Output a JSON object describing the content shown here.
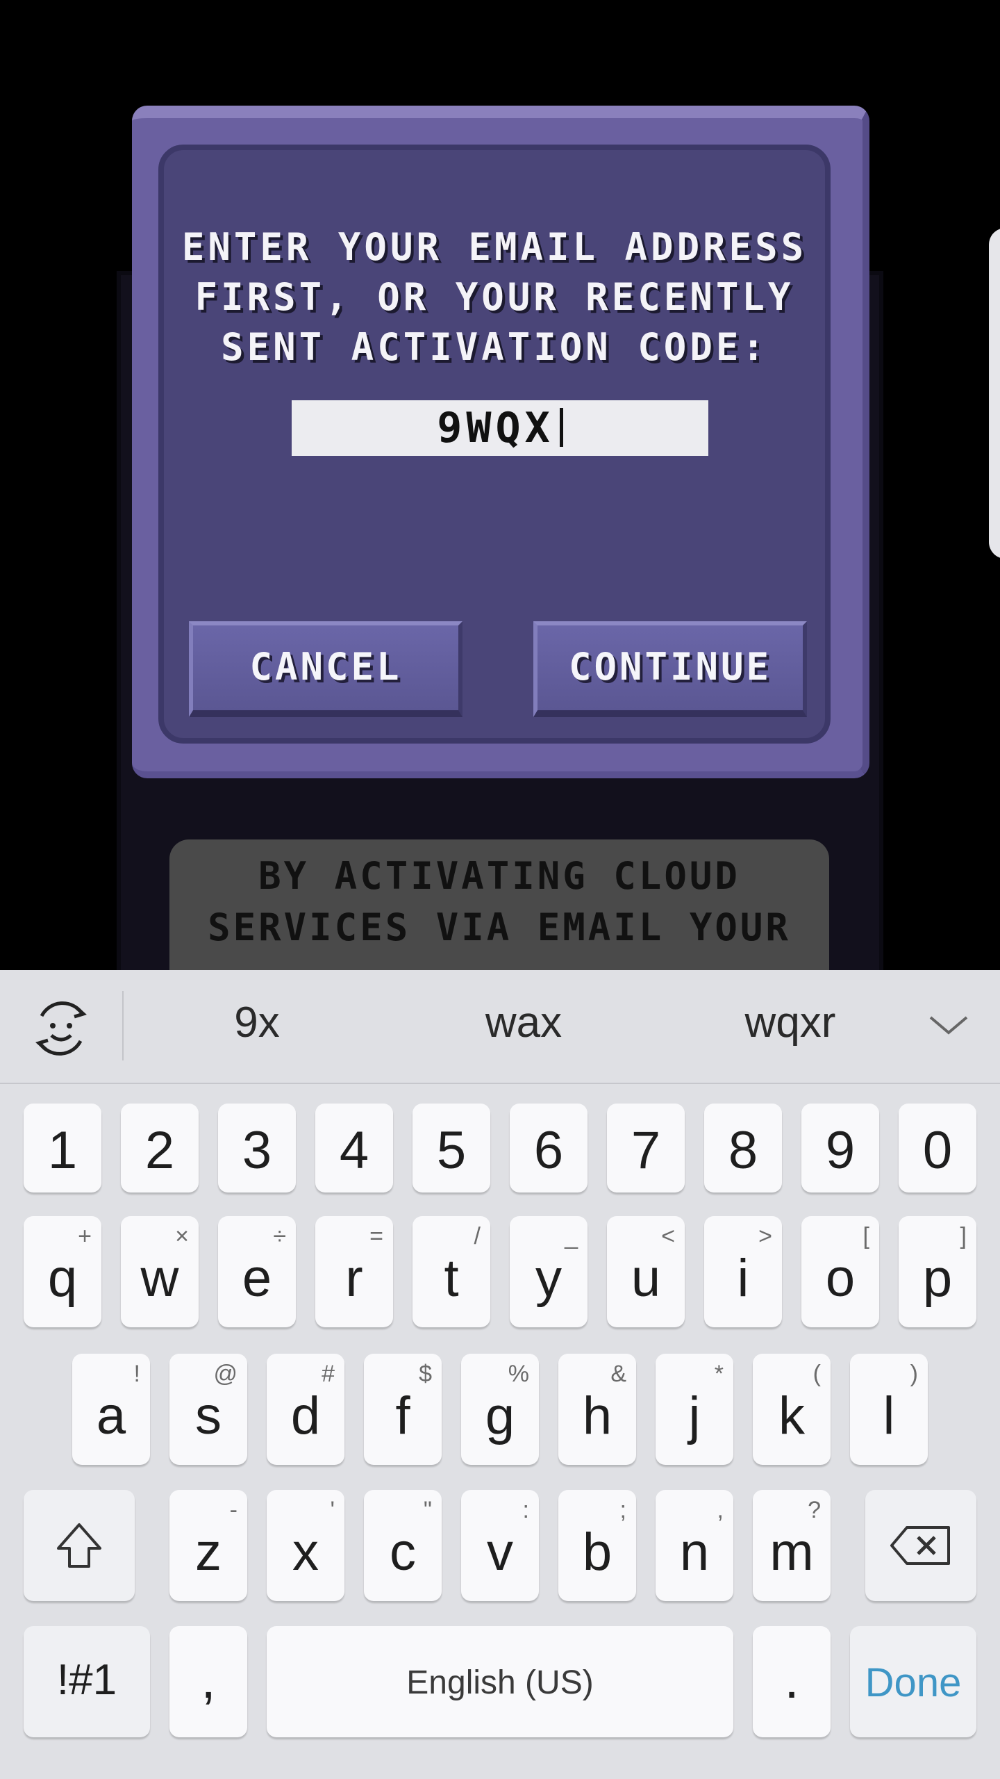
{
  "dialog": {
    "title_lines": [
      "ENTER YOUR EMAIL ADDRESS",
      "FIRST, OR YOUR RECENTLY",
      "SENT ACTIVATION CODE:"
    ],
    "input_value": "9WQX",
    "cancel_label": "CANCEL",
    "continue_label": "CONTINUE"
  },
  "background_card": {
    "lines": [
      "BY ACTIVATING CLOUD",
      "SERVICES VIA EMAIL YOUR"
    ]
  },
  "keyboard": {
    "suggestions": [
      "9x",
      "wax",
      "wqxr"
    ],
    "emoji_icon": "emoji-face-icon",
    "collapse_icon": "chevron-down-icon",
    "number_row": [
      "1",
      "2",
      "3",
      "4",
      "5",
      "6",
      "7",
      "8",
      "9",
      "0"
    ],
    "row1": [
      {
        "key": "q",
        "sub": "+"
      },
      {
        "key": "w",
        "sub": "×"
      },
      {
        "key": "e",
        "sub": "÷"
      },
      {
        "key": "r",
        "sub": "="
      },
      {
        "key": "t",
        "sub": "/"
      },
      {
        "key": "y",
        "sub": "_"
      },
      {
        "key": "u",
        "sub": "<"
      },
      {
        "key": "i",
        "sub": ">"
      },
      {
        "key": "o",
        "sub": "["
      },
      {
        "key": "p",
        "sub": "]"
      }
    ],
    "row2": [
      {
        "key": "a",
        "sub": "!"
      },
      {
        "key": "s",
        "sub": "@"
      },
      {
        "key": "d",
        "sub": "#"
      },
      {
        "key": "f",
        "sub": "$"
      },
      {
        "key": "g",
        "sub": "%"
      },
      {
        "key": "h",
        "sub": "&"
      },
      {
        "key": "j",
        "sub": "*"
      },
      {
        "key": "k",
        "sub": "("
      },
      {
        "key": "l",
        "sub": ")"
      }
    ],
    "row3": [
      {
        "key": "z",
        "sub": "-"
      },
      {
        "key": "x",
        "sub": "'"
      },
      {
        "key": "c",
        "sub": "\""
      },
      {
        "key": "v",
        "sub": ":"
      },
      {
        "key": "b",
        "sub": ";"
      },
      {
        "key": "n",
        "sub": ","
      },
      {
        "key": "m",
        "sub": "?"
      }
    ],
    "symbols_label": "!#1",
    "comma_label": ",",
    "space_label": "English (US)",
    "period_label": ".",
    "done_label": "Done",
    "done_color": "#3f96c6"
  }
}
